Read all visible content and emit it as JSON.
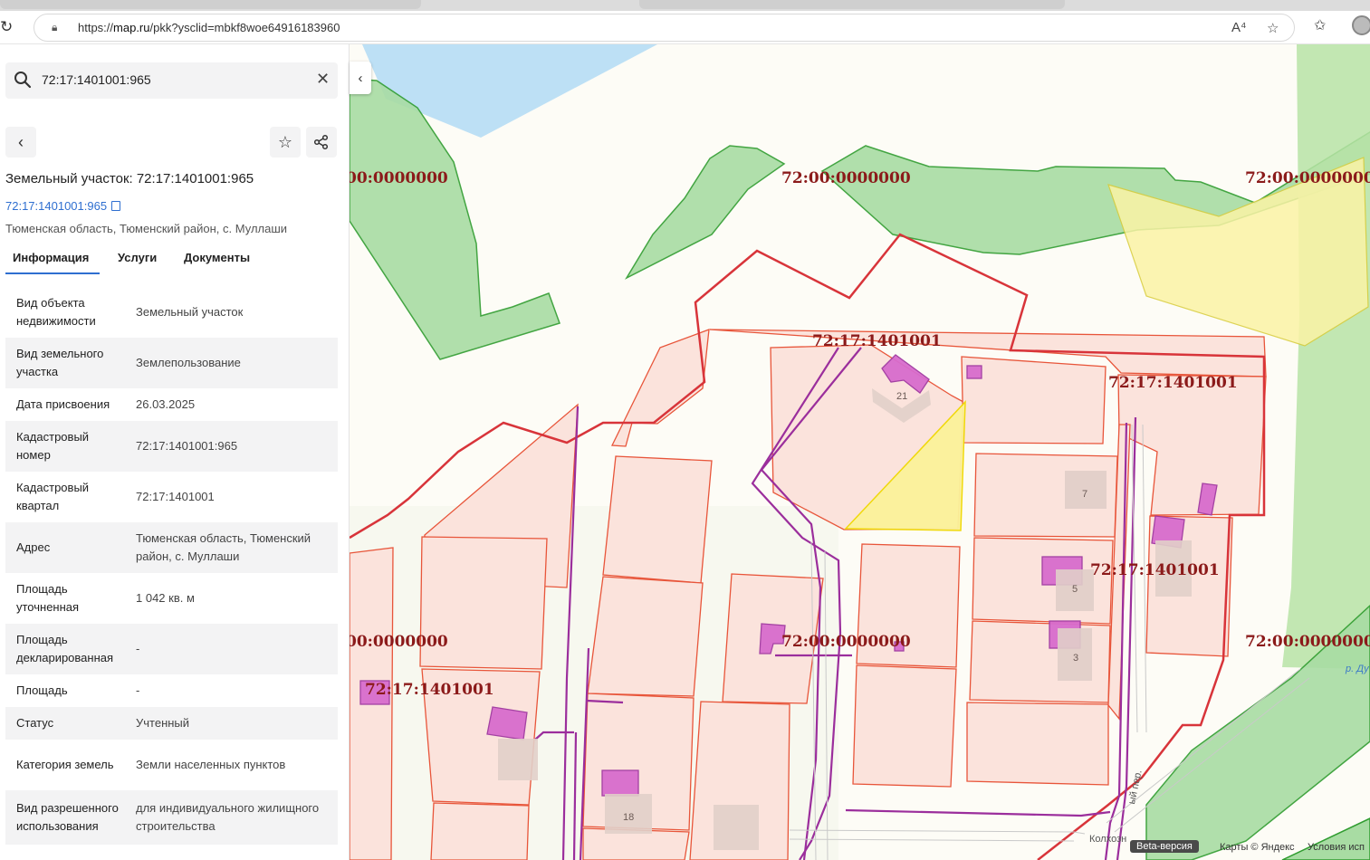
{
  "browser": {
    "url_prefix": "https://",
    "url_host": "map.ru",
    "url_path": "/pkk?ysclid=mbkf8woe64916183960"
  },
  "search": {
    "query": "72:17:1401001:965"
  },
  "object": {
    "title": "Земельный участок: 72:17:1401001:965",
    "link": "72:17:1401001:965",
    "address": "Тюменская область, Тюменский район, с. Муллаши"
  },
  "tabs": [
    {
      "label": "Информация"
    },
    {
      "label": "Услуги"
    },
    {
      "label": "Документы"
    }
  ],
  "attributes": [
    {
      "key": "Вид объекта недвижимости",
      "value": "Земельный участок"
    },
    {
      "key": "Вид земельного участка",
      "value": "Землепользование"
    },
    {
      "key": "Дата присвоения",
      "value": "26.03.2025"
    },
    {
      "key": "Кадастровый номер",
      "value": "72:17:1401001:965"
    },
    {
      "key": "Кадастровый квартал",
      "value": "72:17:1401001"
    },
    {
      "key": "Адрес",
      "value": "Тюменская область, Тюменский район, с. Муллаши"
    },
    {
      "key": "Площадь уточненная",
      "value": "1 042 кв. м"
    },
    {
      "key": "Площадь декларированная",
      "value": "-"
    },
    {
      "key": "Площадь",
      "value": "-"
    },
    {
      "key": "Статус",
      "value": "Учтенный"
    },
    {
      "key": "Категория земель",
      "value": "Земли населенных пунктов"
    },
    {
      "key": "Вид разрешенного использования",
      "value": "для индивидуального жилищного строительства"
    }
  ],
  "map": {
    "labels": {
      "zone_left_top": "00:0000000",
      "zone_center_top": "72:00:0000000",
      "zone_right_top": "72:00:0000000",
      "quarter_center": "72:17:1401001",
      "quarter_right": "72:17:1401001",
      "quarter_mid": "72:17:1401001",
      "zone_left_mid": "00:0000000",
      "zone_center_mid": "72:00:0000000",
      "zone_right_mid": "72:00:0000000",
      "quarter_left": "72:17:1401001"
    },
    "house_numbers": {
      "h21": "21",
      "h7": "7",
      "h5": "5",
      "h3": "3",
      "h18": "18"
    },
    "streets": {
      "kolkhoz": "Колхозн",
      "lane": "ый пер."
    },
    "river": "р. Ду",
    "beta": "Beta-версия",
    "copyright": "Карты © Яндекс",
    "terms": "Условия исп"
  },
  "colors": {
    "accent": "#2f6fd0",
    "parcel_fill": "#fbe3dc",
    "parcel_stroke": "#e8553a",
    "quarter_stroke": "#d8343a",
    "label_color": "#8b1a1a",
    "forest": "#a8dca3",
    "water": "#bde0f5",
    "building": "#d86ccd",
    "selected": "#fbf29a",
    "utility": "#9b2e9c"
  }
}
